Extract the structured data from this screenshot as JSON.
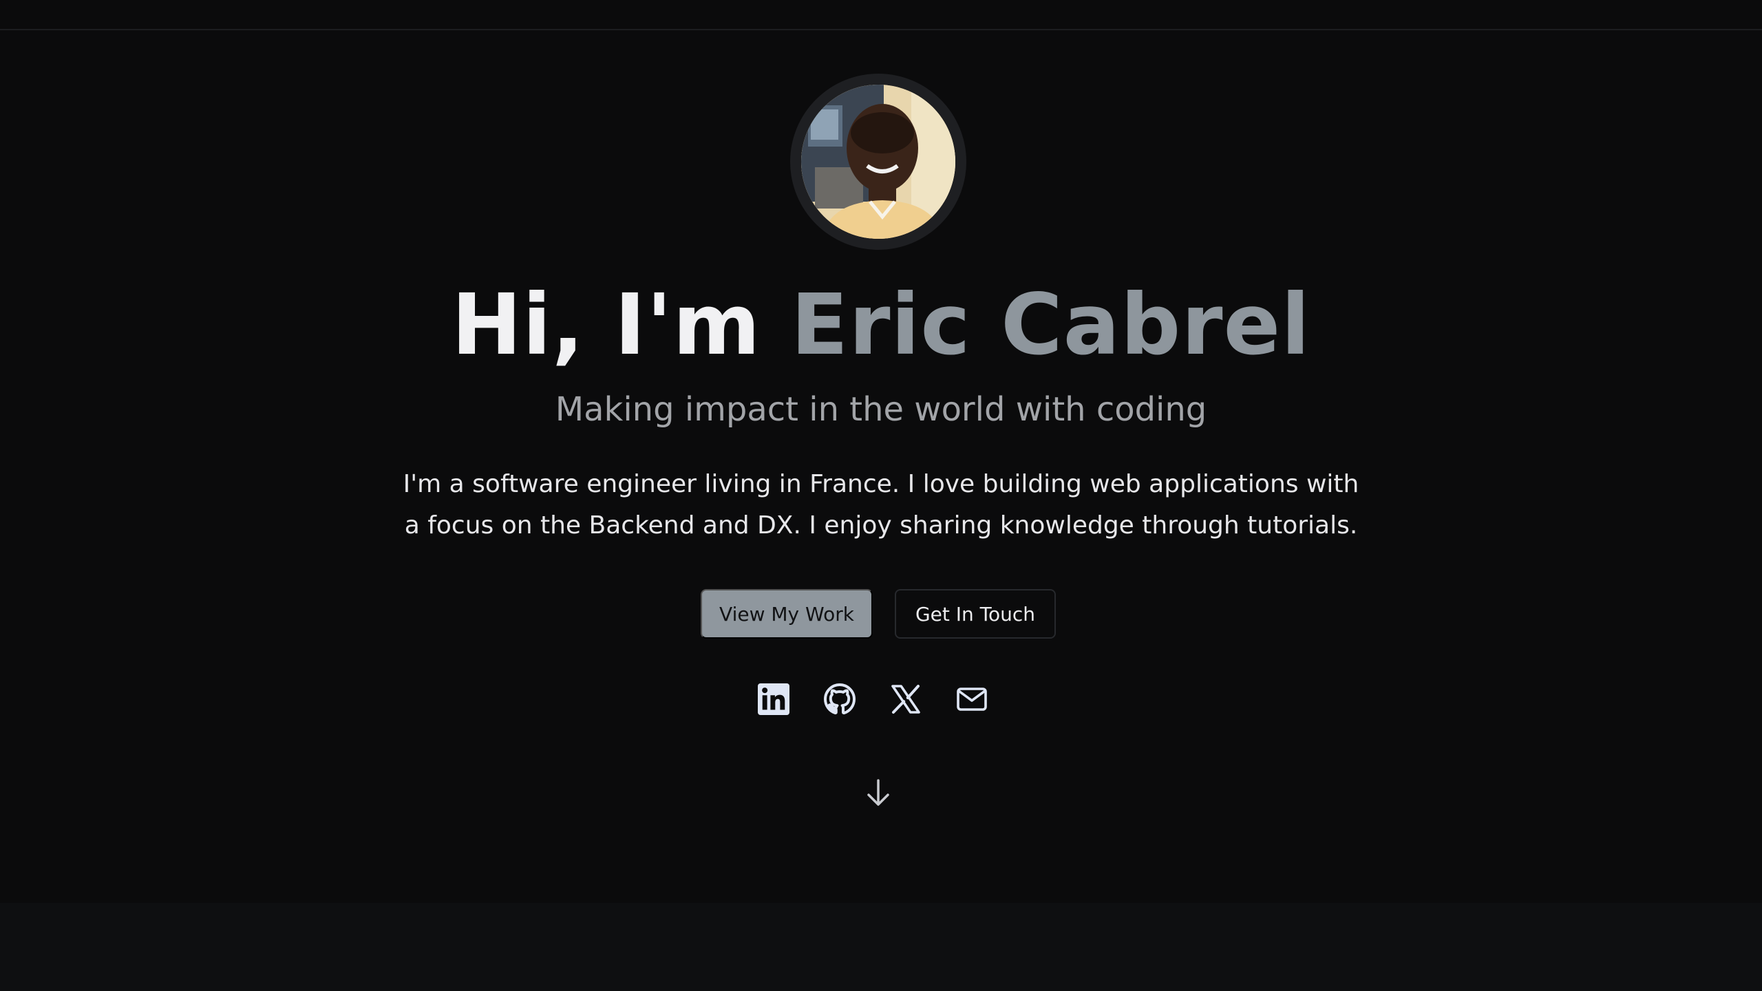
{
  "hero": {
    "greeting": "Hi, I'm",
    "name": "Eric Cabrel",
    "tagline": "Making impact in the world with coding",
    "bio": "I'm a software engineer living in France. I love building web applications with a focus on the Backend and DX. I enjoy sharing knowledge through tutorials.",
    "avatar_alt": "Eric Cabrel"
  },
  "buttons": {
    "primary_label": "View My Work",
    "secondary_label": "Get In Touch"
  },
  "socials": [
    {
      "icon": "linkedin-icon"
    },
    {
      "icon": "github-icon"
    },
    {
      "icon": "x-icon"
    },
    {
      "icon": "mail-icon"
    }
  ],
  "scroll": {
    "icon": "arrow-down-icon"
  },
  "colors": {
    "background": "#0b0b0c",
    "accent_name": "#8e969d",
    "primary_button": "#8f979e",
    "icon_tint": "#dfe6f5"
  }
}
